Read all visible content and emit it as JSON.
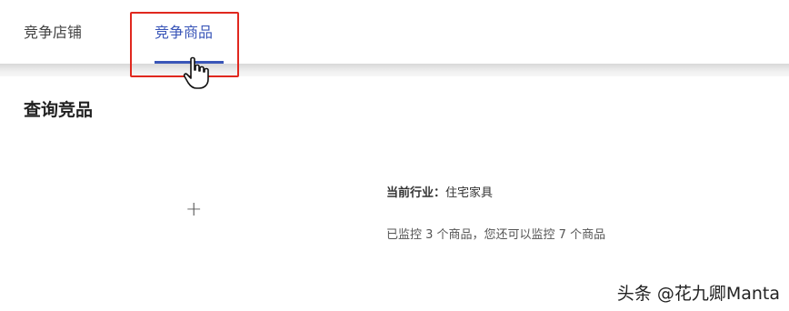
{
  "tabs": [
    {
      "label": "竞争店铺",
      "active": false
    },
    {
      "label": "竞争商品",
      "active": true
    }
  ],
  "section": {
    "title": "查询竞品"
  },
  "add_button": {
    "label": "+"
  },
  "info": {
    "industry_label": "当前行业：",
    "industry_value": "住宅家具",
    "monitor_text": "已监控 3 个商品，您还可以监控 7 个商品"
  },
  "watermark": "头条 @花九卿Manta",
  "colors": {
    "accent": "#3a56b8",
    "highlight": "#e0281e"
  },
  "icons": {
    "cursor": "hand-pointer-icon",
    "add": "plus-icon"
  }
}
